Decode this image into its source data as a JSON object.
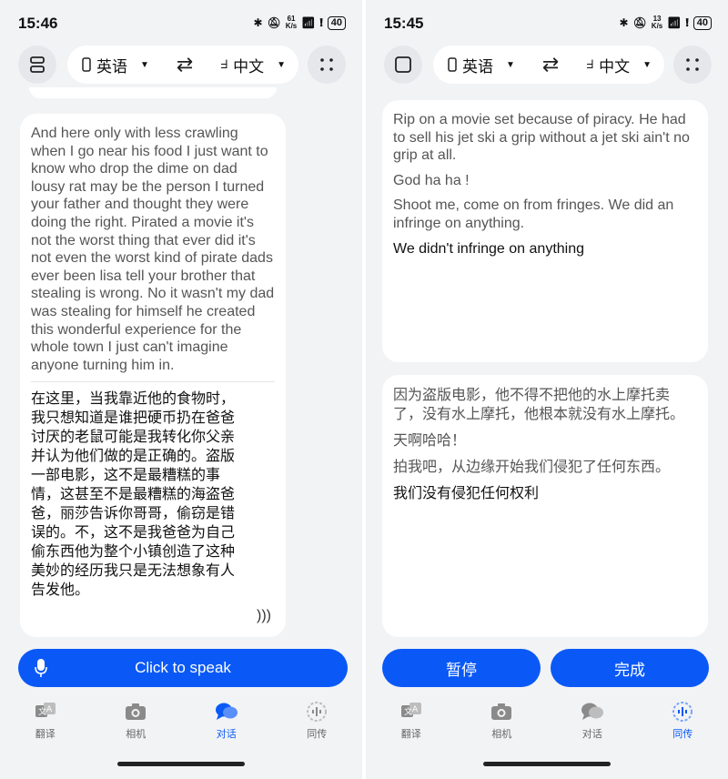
{
  "left": {
    "status": {
      "time": "15:46",
      "speed_num": "61",
      "speed_unit": "K/s",
      "battery": "40"
    },
    "lang_source": "英语",
    "lang_target": "中文",
    "source_text": "And here only with less crawling when I go near his food I just want to know who drop the dime on dad lousy rat may be the person I turned your father and thought they were doing the right. Pirated a movie it's not the worst thing that ever did it's not even the worst kind of pirate dads ever been lisa tell your brother that stealing is wrong. No it wasn't my dad was stealing for himself he created this wonderful experience for the whole town I just can't imagine anyone turning him in.",
    "translated_text": "在这里，当我靠近他的食物时，我只想知道是谁把硬币扔在爸爸讨厌的老鼠可能是我转化你父亲并认为他们做的是正确的。盗版一部电影，这不是最糟糕的事情，这甚至不是最糟糕的海盗爸爸，丽莎告诉你哥哥，偷窃是错误的。不，这不是我爸爸为自己偷东西他为整个小镇创造了这种美妙的经历我只是无法想象有人告发他。",
    "speak_label": "Click to speak"
  },
  "right": {
    "status": {
      "time": "15:45",
      "speed_num": "13",
      "speed_unit": "K/s",
      "battery": "40"
    },
    "lang_source": "英语",
    "lang_target": "中文",
    "source_lines": [
      "Rip on a movie set because of piracy. He had to sell his jet ski a grip without a jet ski ain't no grip at all.",
      "God ha ha !",
      "Shoot me, come on from fringes. We did an infringe on anything."
    ],
    "source_live": "We didn't infringe on anything",
    "translated_lines": [
      "因为盗版电影，他不得不把他的水上摩托卖了，没有水上摩托，他根本就没有水上摩托。",
      "天啊哈哈！",
      "拍我吧，从边缘开始我们侵犯了任何东西。"
    ],
    "translated_live": "我们没有侵犯任何权利",
    "pause_label": "暂停",
    "done_label": "完成"
  },
  "nav": [
    "翻译",
    "相机",
    "对话",
    "同传"
  ],
  "colors": {
    "accent": "#0a59f7",
    "background": "#f2f3f5",
    "card": "#ffffff"
  }
}
